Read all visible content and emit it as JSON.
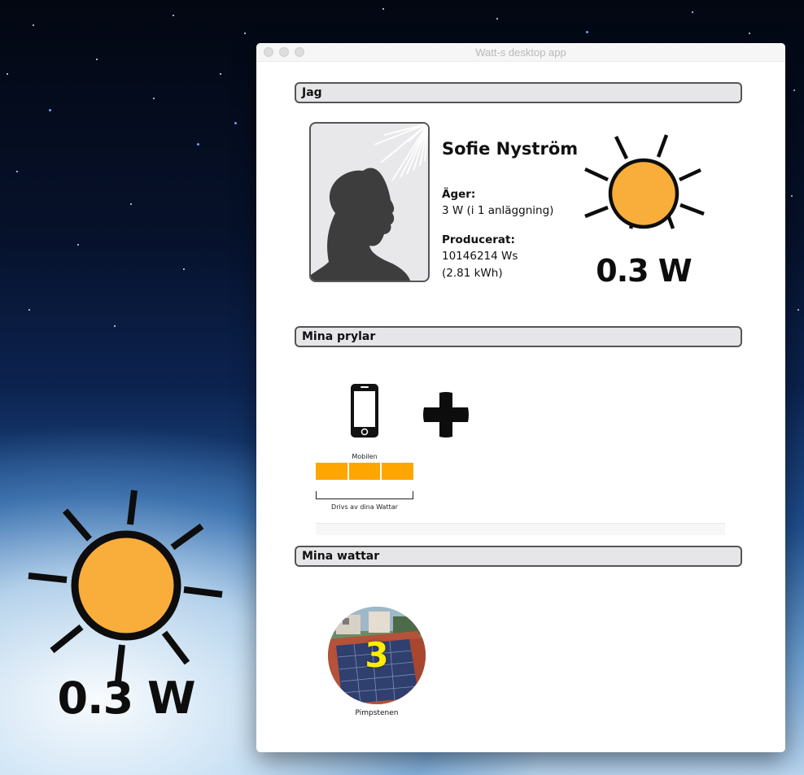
{
  "desktop": {
    "watt_display": "0.3 W"
  },
  "window": {
    "title": "Watt-s desktop app",
    "sections": {
      "jag": "Jag",
      "prylar": "Mina prylar",
      "wattar": "Mina wattar"
    }
  },
  "profile": {
    "name": "Sofie Nyström",
    "owns_label": "Äger:",
    "owns_value": "3 W (i 1 anläggning)",
    "produced_label": "Producerat:",
    "produced_ws": "10146214 Ws",
    "produced_kwh": "(2.81 kWh)",
    "current_power": "0.3 W"
  },
  "devices": [
    {
      "name": "Mobilen",
      "icon": "smartphone-icon",
      "charge_segments_filled": 3,
      "charge_segments_total": 3
    }
  ],
  "devices_power_label": "Drivs av dina Wattar",
  "add_device_icon": "plus-icon",
  "plants": [
    {
      "name": "Pimpstenen",
      "watts": "3"
    }
  ],
  "colors": {
    "sun": "#f9ad3b",
    "battery": "#ffa500",
    "plant_count": "#ffee00"
  }
}
